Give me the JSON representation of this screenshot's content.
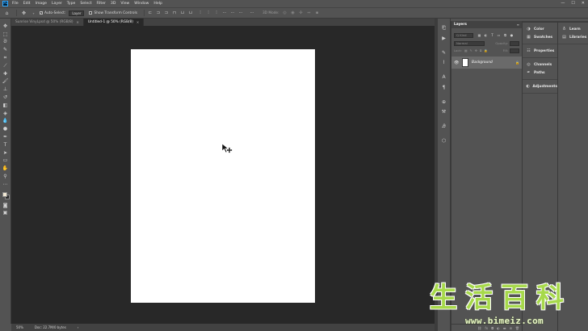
{
  "app": {
    "logo": "Ps",
    "menu": [
      "File",
      "Edit",
      "Image",
      "Layer",
      "Type",
      "Select",
      "Filter",
      "3D",
      "View",
      "Window",
      "Help"
    ],
    "window_controls": [
      "—",
      "☐",
      "✕"
    ]
  },
  "options_bar": {
    "auto_select_label": "Auto-Select:",
    "auto_select_value": "Layer",
    "transform_label": "Show Transform Controls",
    "mode_3d_label": "3D Mode:",
    "more": "···"
  },
  "tabs": [
    {
      "label": "Sunrise VinyLpsd @ 50% (RGB/8)",
      "active": false
    },
    {
      "label": "Untitled-1 @ 50% (RGB/8)",
      "active": true
    }
  ],
  "status": {
    "zoom": "50%",
    "doc_size": "Doc: 22.7M/0 bytes"
  },
  "layers_panel": {
    "tab": "Layers",
    "kind_placeholder": "Q Kind",
    "blend_mode": "Normal",
    "opacity_label": "Opacity:",
    "lock_label": "Lock:",
    "fill_label": "Fill:",
    "layers": [
      {
        "name": "Background",
        "visible": true,
        "locked": true
      }
    ]
  },
  "side_panels": {
    "group1": [
      "Color",
      "Swatches"
    ],
    "group2": [
      "Properties"
    ],
    "group3": [
      "Channels",
      "Paths"
    ],
    "group4": [
      "Adjustments"
    ],
    "group5": [
      "Learn",
      "Libraries"
    ]
  },
  "watermark": {
    "chars": [
      "生",
      "活",
      "百",
      "科"
    ],
    "url": "www.bimeiz.com"
  },
  "colors": {
    "chrome": "#535353",
    "canvas_bg": "#282828",
    "document": "#ffffff",
    "watermark_green": "#a7d94b"
  }
}
